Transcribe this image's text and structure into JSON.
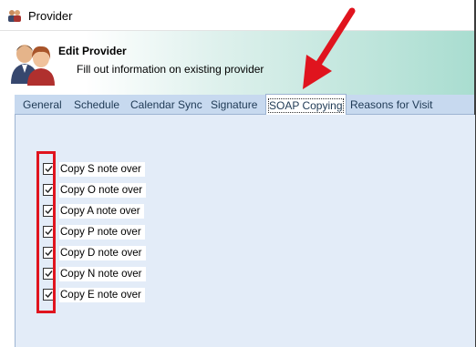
{
  "window": {
    "title": "Provider"
  },
  "header": {
    "title": "Edit Provider",
    "subtitle": "Fill out information on existing provider"
  },
  "tabs": [
    {
      "label": "General",
      "active": false
    },
    {
      "label": "Schedule",
      "active": false
    },
    {
      "label": "Calendar Sync",
      "active": false
    },
    {
      "label": "Signature",
      "active": false
    },
    {
      "label": "SOAP Copying",
      "active": true
    },
    {
      "label": "Reasons for Visit",
      "active": false
    }
  ],
  "soap_copying": {
    "options": [
      {
        "label": "Copy S note over",
        "checked": true
      },
      {
        "label": "Copy O note over",
        "checked": true
      },
      {
        "label": "Copy A note over",
        "checked": true
      },
      {
        "label": "Copy P note over",
        "checked": true
      },
      {
        "label": "Copy D note over",
        "checked": true
      },
      {
        "label": "Copy N note over",
        "checked": true
      },
      {
        "label": "Copy E note over",
        "checked": true
      }
    ]
  },
  "annotations": {
    "highlight_color": "#e0141e",
    "arrow_color": "#e0141e"
  },
  "icons": {
    "app": "users-icon",
    "header": "users-icon",
    "checkbox": "checkmark-icon"
  }
}
